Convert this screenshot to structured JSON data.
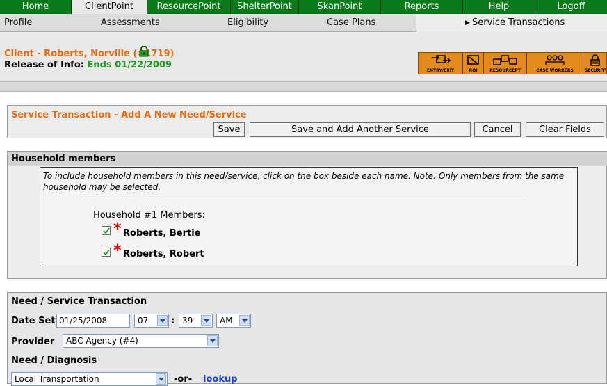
{
  "top_nav": {
    "tabs": [
      {
        "label": "Home"
      },
      {
        "label": "ClientPoint"
      },
      {
        "label": "ResourcePoint"
      },
      {
        "label": "ShelterPoint"
      },
      {
        "label": "SkanPoint"
      },
      {
        "label": "Reports"
      },
      {
        "label": "Help"
      },
      {
        "label": "Logoff"
      }
    ],
    "active": "ClientPoint",
    "color": "#0a7a1b"
  },
  "sub_nav": {
    "items": [
      {
        "label": "Profile"
      },
      {
        "label": "Assessments"
      },
      {
        "label": "Eligibility"
      },
      {
        "label": "Case Plans"
      },
      {
        "label": "Service Transactions"
      }
    ],
    "active": "Service Transactions"
  },
  "client": {
    "name": "Client - Roberts, Norville (#1719)",
    "roi_label": "Release of Info:",
    "roi_value": "Ends 01/22/2009",
    "lock_icon": "lock-icon"
  },
  "icon_toolbar": {
    "items": [
      {
        "label": "ENTRY/EXIT",
        "icon": "entry-exit-icon"
      },
      {
        "label": "ROI",
        "icon": "roi-icon"
      },
      {
        "label": "RESOURCEPT",
        "icon": "resourcept-icon"
      },
      {
        "label": "CASE WORKERS",
        "icon": "case-workers-icon"
      },
      {
        "label": "SECURITY",
        "icon": "security-icon"
      }
    ],
    "color": "#e38a1d"
  },
  "service_transaction": {
    "title": "Service Transaction - Add A New Need/Service",
    "buttons": {
      "save": "Save",
      "save_add": "Save and Add Another Service",
      "cancel": "Cancel",
      "clear": "Clear Fields"
    }
  },
  "household": {
    "title": "Household members",
    "note": "To include household members in this need/service, click on the box beside each name. Note: Only members from the same household may be selected.",
    "group_label": "Household #1 Members:",
    "members": [
      {
        "name": "Roberts, Bertie",
        "checked": true
      },
      {
        "name": "Roberts, Robert",
        "checked": true
      }
    ]
  },
  "need_service": {
    "title": "Need / Service Transaction",
    "date_set_label": "Date Set",
    "date_value": "01/25/2008",
    "hour": "07",
    "time_sep": ":",
    "minute": "39",
    "ampm": "AM",
    "provider_label": "Provider",
    "provider_value": "ABC Agency (#4)",
    "need_label": "Need / Diagnosis",
    "need_value": "Local Transportation",
    "or_text": "-or-",
    "lookup_text": "lookup"
  }
}
